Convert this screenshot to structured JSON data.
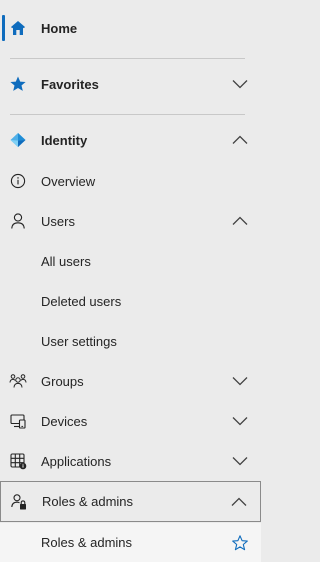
{
  "nav": {
    "home": {
      "label": "Home",
      "icon": "home-icon"
    },
    "favorites": {
      "label": "Favorites",
      "icon": "star-icon"
    },
    "identity": {
      "label": "Identity",
      "icon": "identity-diamond-icon"
    },
    "overview": {
      "label": "Overview",
      "icon": "info-icon"
    },
    "users": {
      "label": "Users",
      "icon": "person-icon"
    },
    "all_users": {
      "label": "All users"
    },
    "deleted_users": {
      "label": "Deleted users"
    },
    "user_settings": {
      "label": "User settings"
    },
    "groups": {
      "label": "Groups",
      "icon": "people-group-icon"
    },
    "devices": {
      "label": "Devices",
      "icon": "devices-icon"
    },
    "applications": {
      "label": "Applications",
      "icon": "apps-grid-icon"
    },
    "roles_admins": {
      "label": "Roles & admins",
      "icon": "person-lock-icon"
    },
    "roles_admins_sub": {
      "label": "Roles & admins",
      "icon": "star-outline-icon"
    }
  },
  "colors": {
    "accent": "#0f6cbd",
    "background": "#ebebeb",
    "submenu_bg": "#f5f5f5"
  }
}
